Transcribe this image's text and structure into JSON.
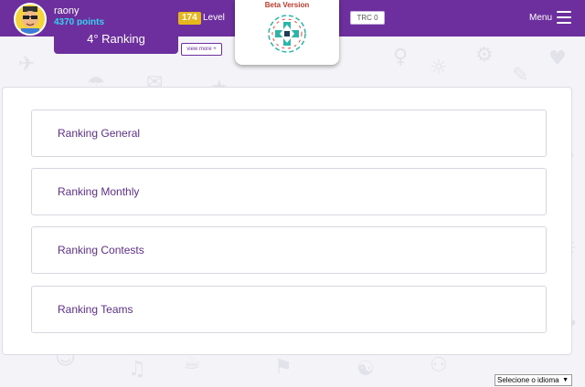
{
  "header": {
    "user_name": "raony",
    "points": "4370 points",
    "level_number": "174",
    "level_label": "Level",
    "trc": "TRC 0",
    "menu_label": "Menu",
    "ranking_position": "4° Ranking",
    "view_more": "view more +",
    "beta_label": "Beta Version"
  },
  "rankings": [
    {
      "label": "Ranking General"
    },
    {
      "label": "Ranking Monthly"
    },
    {
      "label": "Ranking Contests"
    },
    {
      "label": "Ranking Teams"
    }
  ],
  "language": {
    "selected": "Selecione o idioma"
  },
  "colors": {
    "brand_purple": "#6d2f9e",
    "points_cyan": "#34d3ef",
    "level_gold": "#e6b71d",
    "beta_red": "#c0392b"
  }
}
